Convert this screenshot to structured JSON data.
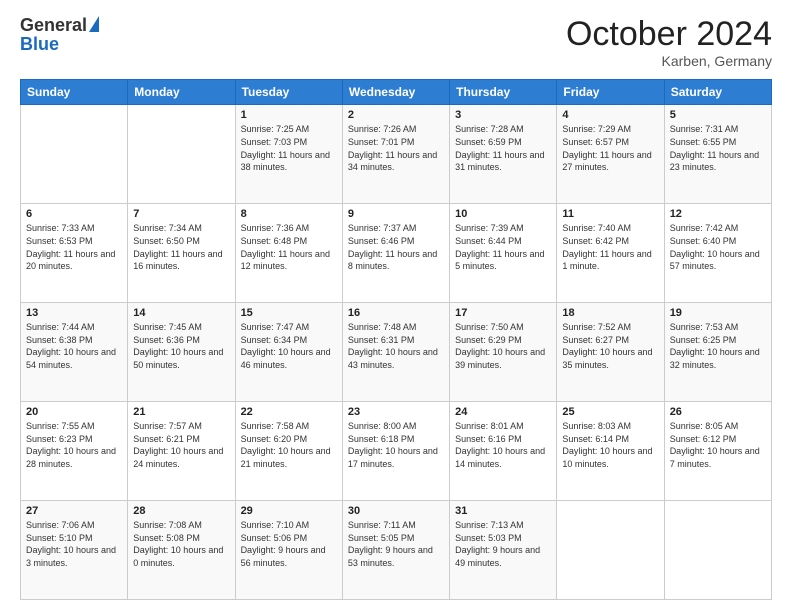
{
  "header": {
    "logo_general": "General",
    "logo_blue": "Blue",
    "month": "October 2024",
    "location": "Karben, Germany"
  },
  "days_of_week": [
    "Sunday",
    "Monday",
    "Tuesday",
    "Wednesday",
    "Thursday",
    "Friday",
    "Saturday"
  ],
  "weeks": [
    [
      {
        "day": "",
        "info": ""
      },
      {
        "day": "",
        "info": ""
      },
      {
        "day": "1",
        "info": "Sunrise: 7:25 AM\nSunset: 7:03 PM\nDaylight: 11 hours and 38 minutes."
      },
      {
        "day": "2",
        "info": "Sunrise: 7:26 AM\nSunset: 7:01 PM\nDaylight: 11 hours and 34 minutes."
      },
      {
        "day": "3",
        "info": "Sunrise: 7:28 AM\nSunset: 6:59 PM\nDaylight: 11 hours and 31 minutes."
      },
      {
        "day": "4",
        "info": "Sunrise: 7:29 AM\nSunset: 6:57 PM\nDaylight: 11 hours and 27 minutes."
      },
      {
        "day": "5",
        "info": "Sunrise: 7:31 AM\nSunset: 6:55 PM\nDaylight: 11 hours and 23 minutes."
      }
    ],
    [
      {
        "day": "6",
        "info": "Sunrise: 7:33 AM\nSunset: 6:53 PM\nDaylight: 11 hours and 20 minutes."
      },
      {
        "day": "7",
        "info": "Sunrise: 7:34 AM\nSunset: 6:50 PM\nDaylight: 11 hours and 16 minutes."
      },
      {
        "day": "8",
        "info": "Sunrise: 7:36 AM\nSunset: 6:48 PM\nDaylight: 11 hours and 12 minutes."
      },
      {
        "day": "9",
        "info": "Sunrise: 7:37 AM\nSunset: 6:46 PM\nDaylight: 11 hours and 8 minutes."
      },
      {
        "day": "10",
        "info": "Sunrise: 7:39 AM\nSunset: 6:44 PM\nDaylight: 11 hours and 5 minutes."
      },
      {
        "day": "11",
        "info": "Sunrise: 7:40 AM\nSunset: 6:42 PM\nDaylight: 11 hours and 1 minute."
      },
      {
        "day": "12",
        "info": "Sunrise: 7:42 AM\nSunset: 6:40 PM\nDaylight: 10 hours and 57 minutes."
      }
    ],
    [
      {
        "day": "13",
        "info": "Sunrise: 7:44 AM\nSunset: 6:38 PM\nDaylight: 10 hours and 54 minutes."
      },
      {
        "day": "14",
        "info": "Sunrise: 7:45 AM\nSunset: 6:36 PM\nDaylight: 10 hours and 50 minutes."
      },
      {
        "day": "15",
        "info": "Sunrise: 7:47 AM\nSunset: 6:34 PM\nDaylight: 10 hours and 46 minutes."
      },
      {
        "day": "16",
        "info": "Sunrise: 7:48 AM\nSunset: 6:31 PM\nDaylight: 10 hours and 43 minutes."
      },
      {
        "day": "17",
        "info": "Sunrise: 7:50 AM\nSunset: 6:29 PM\nDaylight: 10 hours and 39 minutes."
      },
      {
        "day": "18",
        "info": "Sunrise: 7:52 AM\nSunset: 6:27 PM\nDaylight: 10 hours and 35 minutes."
      },
      {
        "day": "19",
        "info": "Sunrise: 7:53 AM\nSunset: 6:25 PM\nDaylight: 10 hours and 32 minutes."
      }
    ],
    [
      {
        "day": "20",
        "info": "Sunrise: 7:55 AM\nSunset: 6:23 PM\nDaylight: 10 hours and 28 minutes."
      },
      {
        "day": "21",
        "info": "Sunrise: 7:57 AM\nSunset: 6:21 PM\nDaylight: 10 hours and 24 minutes."
      },
      {
        "day": "22",
        "info": "Sunrise: 7:58 AM\nSunset: 6:20 PM\nDaylight: 10 hours and 21 minutes."
      },
      {
        "day": "23",
        "info": "Sunrise: 8:00 AM\nSunset: 6:18 PM\nDaylight: 10 hours and 17 minutes."
      },
      {
        "day": "24",
        "info": "Sunrise: 8:01 AM\nSunset: 6:16 PM\nDaylight: 10 hours and 14 minutes."
      },
      {
        "day": "25",
        "info": "Sunrise: 8:03 AM\nSunset: 6:14 PM\nDaylight: 10 hours and 10 minutes."
      },
      {
        "day": "26",
        "info": "Sunrise: 8:05 AM\nSunset: 6:12 PM\nDaylight: 10 hours and 7 minutes."
      }
    ],
    [
      {
        "day": "27",
        "info": "Sunrise: 7:06 AM\nSunset: 5:10 PM\nDaylight: 10 hours and 3 minutes."
      },
      {
        "day": "28",
        "info": "Sunrise: 7:08 AM\nSunset: 5:08 PM\nDaylight: 10 hours and 0 minutes."
      },
      {
        "day": "29",
        "info": "Sunrise: 7:10 AM\nSunset: 5:06 PM\nDaylight: 9 hours and 56 minutes."
      },
      {
        "day": "30",
        "info": "Sunrise: 7:11 AM\nSunset: 5:05 PM\nDaylight: 9 hours and 53 minutes."
      },
      {
        "day": "31",
        "info": "Sunrise: 7:13 AM\nSunset: 5:03 PM\nDaylight: 9 hours and 49 minutes."
      },
      {
        "day": "",
        "info": ""
      },
      {
        "day": "",
        "info": ""
      }
    ]
  ]
}
